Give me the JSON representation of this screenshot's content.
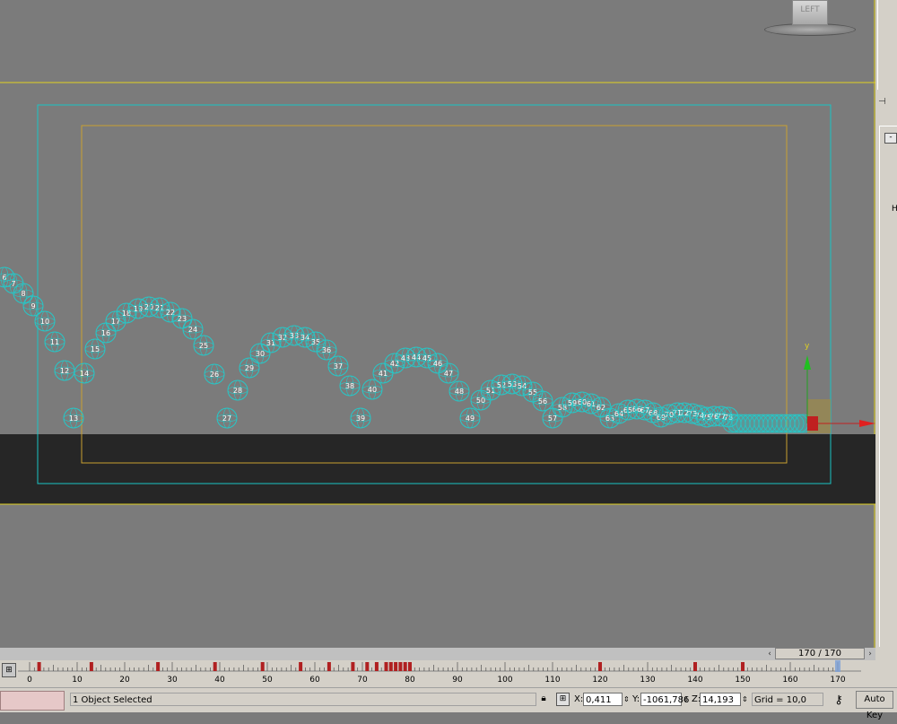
{
  "viewport": {
    "label": "LEFT",
    "frames_upper": [
      "6",
      "7",
      "8",
      "9",
      "10",
      "11",
      "12",
      "13",
      "14",
      "15",
      "16",
      "17",
      "18",
      "19",
      "20",
      "21",
      "22",
      "23",
      "24",
      "25",
      "26",
      "27",
      "28",
      "29",
      "30",
      "31",
      "32",
      "33",
      "34",
      "35",
      "36",
      "37",
      "38",
      "39",
      "40",
      "41",
      "42",
      "43",
      "44",
      "45",
      "46",
      "47",
      "48",
      "49",
      "50",
      "51",
      "52",
      "53",
      "54",
      "55",
      "56",
      "57",
      "58",
      "59",
      "60",
      "61",
      "62",
      "63",
      "64",
      "65",
      "66",
      "67",
      "68",
      "69",
      "70",
      "71",
      "72",
      "73",
      "74",
      "75",
      "76",
      "77",
      "78"
    ]
  },
  "timeline": {
    "current": "170 / 170",
    "ticks": [
      "0",
      "10",
      "20",
      "30",
      "40",
      "50",
      "60",
      "70",
      "80",
      "90",
      "100",
      "110",
      "120",
      "130",
      "140",
      "150",
      "160",
      "170"
    ]
  },
  "status": {
    "selection": "1 Object Selected",
    "x_label": "X:",
    "x_value": "0,411",
    "y_label": "Y:",
    "y_value": "-1061,786",
    "z_label": "Z:",
    "z_value": "14,193",
    "grid": "Grid = 10,0",
    "autokey": "Auto Key"
  },
  "colors": {
    "viewport_bg": "#7b7b7b",
    "floor": "#262626",
    "safe_outer": "#19c4c4",
    "safe_inner": "#c8a030",
    "viewport_border": "#e0d020",
    "sphere": "#26c8c8",
    "panel": "#d4d0c8"
  }
}
